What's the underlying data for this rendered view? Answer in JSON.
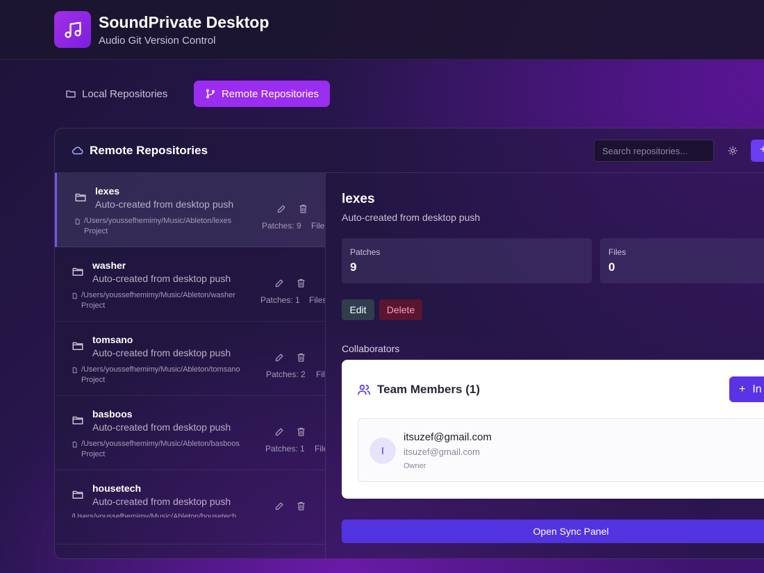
{
  "app": {
    "title": "SoundPrivate Desktop",
    "subtitle": "Audio Git Version Control",
    "logo_icon": "music-note-icon"
  },
  "tabs": [
    {
      "label": "Local Repositories",
      "icon": "folder-icon",
      "active": false
    },
    {
      "label": "Remote Repositories",
      "icon": "git-branch-icon",
      "active": true
    }
  ],
  "panel": {
    "title": "Remote Repositories",
    "title_icon": "cloud-icon",
    "search_placeholder": "Search repositories...",
    "theme_icon": "sun-icon"
  },
  "repos": [
    {
      "name": "lexes",
      "description": "Auto-created from desktop push",
      "path": "/Users/youssefhemimy/Music/Ableton/lexes",
      "path_suffix": "Project",
      "patches": "Patches: 9",
      "files": "Files:",
      "active": true
    },
    {
      "name": "washer",
      "description": "Auto-created from desktop push",
      "path": "/Users/youssefhemimy/Music/Ableton/washer",
      "path_suffix": "Project",
      "patches": "Patches: 1",
      "files": "Files",
      "active": false
    },
    {
      "name": "tomsano",
      "description": "Auto-created from desktop push",
      "path": "/Users/youssefhemimy/Music/Ableton/tomsano",
      "path_suffix": "Project",
      "patches": "Patches: 2",
      "files": "Fil",
      "active": false
    },
    {
      "name": "basboos",
      "description": "Auto-created from desktop push",
      "path": "/Users/youssefhemimy/Music/Ableton/basboos",
      "path_suffix": "Project",
      "patches": "Patches: 1",
      "files": "File",
      "active": false
    },
    {
      "name": "housetech",
      "description": "Auto-created from desktop push",
      "path": "/Users/youssefhemimy/Music/Ableton/housetech",
      "path_suffix": "",
      "patches": "",
      "files": "",
      "active": false
    }
  ],
  "detail": {
    "name": "lexes",
    "description": "Auto-created from desktop push",
    "stats": {
      "patches_label": "Patches",
      "patches_value": "9",
      "files_label": "Files",
      "files_value": "0"
    },
    "edit_label": "Edit",
    "delete_label": "Delete",
    "collaborators_label": "Collaborators",
    "team": {
      "title": "Team Members (1)",
      "invite_label": "In",
      "members": [
        {
          "initial": "I",
          "name": "itsuzef@gmail.com",
          "email": "itsuzef@gmail.com",
          "role": "Owner"
        }
      ]
    },
    "sync_label": "Open Sync Panel"
  },
  "colors": {
    "accent": "#9a2df0",
    "primary_button": "#5233e0",
    "delete_text": "#ff9fb4"
  }
}
